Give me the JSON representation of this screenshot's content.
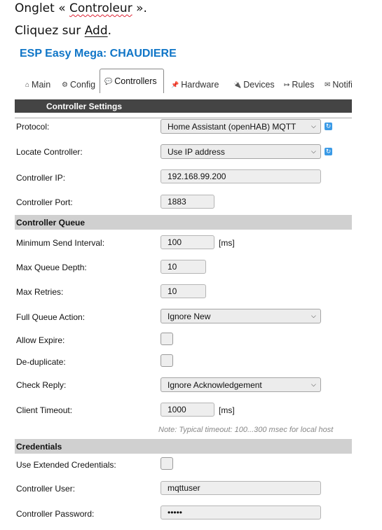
{
  "doc": {
    "line1_pre": "Onglet « ",
    "line1_word": "Controleur",
    "line1_post": " ».",
    "line2_pre": "Cliquez sur ",
    "line2_word": "Add",
    "line2_post": "."
  },
  "app": {
    "title": "ESP Easy Mega: CHAUDIERE"
  },
  "tabs": [
    {
      "icon": "⌂",
      "label": "Main"
    },
    {
      "icon": "⚙",
      "label": "Config"
    },
    {
      "icon": "💬",
      "label": "Controllers"
    },
    {
      "icon": "📌",
      "label": "Hardware"
    },
    {
      "icon": "🔌",
      "label": "Devices"
    },
    {
      "icon": "↦",
      "label": "Rules"
    },
    {
      "icon": "✉",
      "label": "Notifi"
    }
  ],
  "sections": {
    "controller_settings": "Controller Settings",
    "controller_queue": "Controller Queue",
    "credentials": "Credentials"
  },
  "fields": {
    "protocol": {
      "label": "Protocol:",
      "value": "Home Assistant (openHAB) MQTT"
    },
    "locate": {
      "label": "Locate Controller:",
      "value": "Use IP address"
    },
    "ip": {
      "label": "Controller IP:",
      "value": "192.168.99.200"
    },
    "port": {
      "label": "Controller Port:",
      "value": "1883"
    },
    "min_send": {
      "label": "Minimum Send Interval:",
      "value": "100",
      "unit": "[ms]"
    },
    "max_queue": {
      "label": "Max Queue Depth:",
      "value": "10"
    },
    "max_retries": {
      "label": "Max Retries:",
      "value": "10"
    },
    "full_queue": {
      "label": "Full Queue Action:",
      "value": "Ignore New"
    },
    "allow_expire": {
      "label": "Allow Expire:",
      "checked": false
    },
    "dedup": {
      "label": "De-duplicate:",
      "checked": false
    },
    "check_reply": {
      "label": "Check Reply:",
      "value": "Ignore Acknowledgement"
    },
    "client_timeout": {
      "label": "Client Timeout:",
      "value": "1000",
      "unit": "[ms]",
      "note": "Note: Typical timeout: 100...300 msec for local host"
    },
    "ext_cred": {
      "label": "Use Extended Credentials:",
      "checked": false
    },
    "user": {
      "label": "Controller User:",
      "value": "mqttuser"
    },
    "password": {
      "label": "Controller Password:",
      "value": "•••••"
    }
  },
  "colors": {
    "title_blue": "#0f75c7",
    "dark_header": "#444444",
    "gray_header": "#d0d0d0",
    "refresh_blue": "#3a9ae6"
  }
}
